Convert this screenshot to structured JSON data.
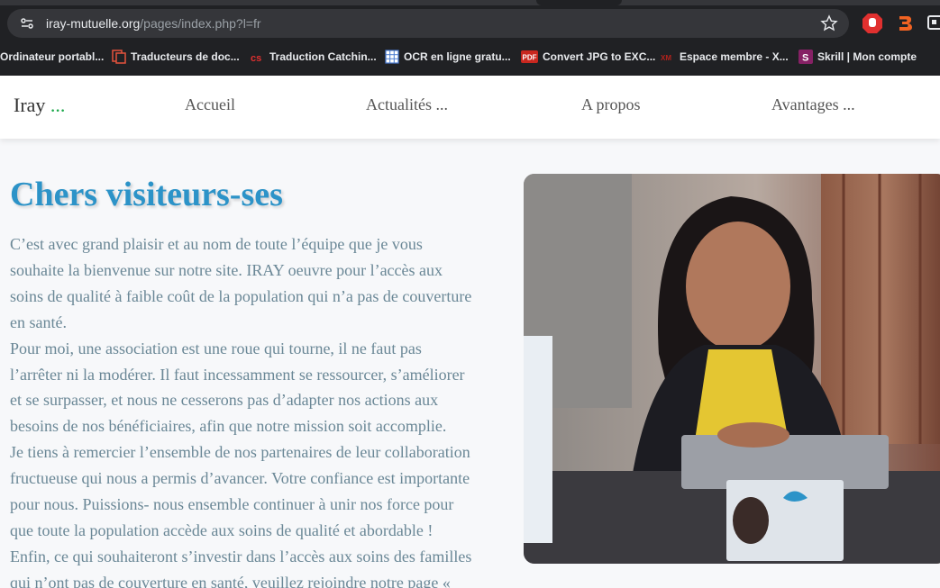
{
  "browser": {
    "url_host": "iray-mutuelle.org",
    "url_path": "/pages/index.php?l=fr",
    "bookmarks": [
      {
        "label": "Ordinateur portabl...",
        "icon": "none"
      },
      {
        "label": "Traducteurs de doc...",
        "icon": "document-translate-icon"
      },
      {
        "label": "Traduction Catchin...",
        "icon": "catchin-icon"
      },
      {
        "label": "OCR en ligne gratu...",
        "icon": "ocr-grid-icon"
      },
      {
        "label": "Convert JPG to EXC...",
        "icon": "pdf-icon",
        "badge": "PDF"
      },
      {
        "label": "Espace membre - X...",
        "icon": "xm-icon",
        "badge": "XM"
      },
      {
        "label": "Skrill | Mon compte",
        "icon": "skrill-icon",
        "badge": "S"
      }
    ],
    "extensions": [
      "hand-stop-icon",
      "b-extension-icon",
      "screen-extension-icon"
    ]
  },
  "site": {
    "brand": "Iray",
    "brand_suffix": "...",
    "nav": [
      "Accueil",
      "Actualités ...",
      "A propos",
      "Avantages ..."
    ]
  },
  "main": {
    "heading": "Chers visiteurs-ses",
    "lines": [
      "C’est avec grand plaisir et au nom de toute l’équipe que je vous",
      "souhaite la bienvenue sur notre site. IRAY oeuvre pour l’accès aux",
      "soins de qualité à faible coût de la population qui n’a pas de couverture",
      "en santé.",
      "Pour moi, une association est une roue qui tourne, il ne faut pas",
      "l’arrêter ni la modérer. Il faut incessamment se ressourcer, s’améliorer",
      "et se surpasser, et nous ne cesserons pas d’adapter nos actions aux",
      "besoins de nos bénéficiaires, afin que notre mission soit accomplie.",
      "Je tiens à remercier l’ensemble de nos partenaires de leur collaboration",
      "fructueuse qui nous a permis d’avancer. Votre confiance est importante",
      "pour nous. Puissions- nous ensemble continuer à unir nos force pour",
      "que toute la population accède aux soins de qualité et abordable !",
      "Enfin, ce qui souhaiteront s’investir dans l’accès aux soins des familles",
      "qui n’ont pas de couverture en santé, veuillez rejoindre notre page «"
    ]
  },
  "colors": {
    "chrome_bg": "#202124",
    "heading": "#2c93c8",
    "body_text": "#6a8796",
    "brand_dots": "#1aa84a"
  }
}
